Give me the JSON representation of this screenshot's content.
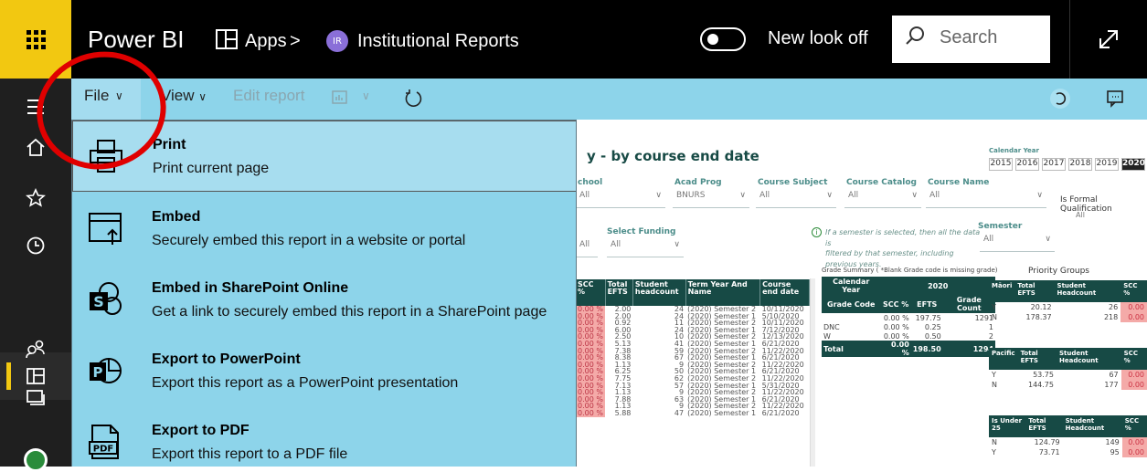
{
  "topbar": {
    "brand": "Power BI",
    "apps_label": "Apps",
    "separator": ">",
    "report_badge": "IR",
    "report_name": "Institutional Reports",
    "new_look_label": "New look off",
    "search_placeholder": "Search"
  },
  "commandbar": {
    "file_label": "File",
    "view_label": "View",
    "edit_label": "Edit report"
  },
  "file_menu": [
    {
      "title": "Print",
      "desc": "Print current page"
    },
    {
      "title": "Embed",
      "desc": "Securely embed this report in a website or portal"
    },
    {
      "title": "Embed in SharePoint Online",
      "desc": "Get a link to securely embed this report in a SharePoint page"
    },
    {
      "title": "Export to PowerPoint",
      "desc": "Export this report as a PowerPoint presentation"
    },
    {
      "title": "Export to PDF",
      "desc": "Export this report to a PDF file"
    }
  ],
  "report": {
    "title": "y  -  by course end date",
    "calendar_year_label": "Calendar Year",
    "years": [
      "2015",
      "2016",
      "2017",
      "2018",
      "2019",
      "2020"
    ],
    "selected_year": "2020",
    "filters": {
      "school_label": "chool",
      "school_value": "All",
      "acad_prog_label": "Acad Prog",
      "acad_prog_value": "BNURS",
      "course_subject_label": "Course Subject",
      "course_subject_value": "All",
      "course_catalog_label": "Course Catalog",
      "course_catalog_value": "All",
      "course_name_label": "Course Name",
      "course_name_value": "All",
      "formal_qual_label": "Is Formal Qualification",
      "formal_qual_value": "All",
      "select_funding_label": "Select Funding",
      "select_funding_value": "All",
      "semester_label": "Semester",
      "semester_value": "All",
      "unlabeled_value": "All",
      "note_line1": "If a semester is selected, then all the data is",
      "note_line2": "filtered by that semester, including previous years."
    },
    "main_table": {
      "headers": [
        "SCC %",
        "Total EFTS",
        "Student headcount",
        "Term Year And Name",
        "Course end date"
      ],
      "rows": [
        [
          "0.00 %",
          "2.00",
          "24",
          "(2020) Semester 2",
          "10/11/2020"
        ],
        [
          "0.00 %",
          "2.00",
          "24",
          "(2020) Semester 1",
          "5/10/2020"
        ],
        [
          "0.00 %",
          "0.92",
          "11",
          "(2020) Semester 2",
          "10/11/2020"
        ],
        [
          "0.00 %",
          "6.00",
          "24",
          "(2020) Semester 1",
          "7/12/2020"
        ],
        [
          "0.00 %",
          "2.50",
          "10",
          "(2020) Semester 2",
          "12/13/2020"
        ],
        [
          "0.00 %",
          "5.13",
          "41",
          "(2020) Semester 1",
          "6/21/2020"
        ],
        [
          "0.00 %",
          "7.38",
          "59",
          "(2020) Semester 2",
          "11/22/2020"
        ],
        [
          "0.00 %",
          "8.38",
          "67",
          "(2020) Semester 1",
          "6/21/2020"
        ],
        [
          "0.00 %",
          "1.13",
          "9",
          "(2020) Semester 2",
          "11/22/2020"
        ],
        [
          "0.00 %",
          "6.25",
          "50",
          "(2020) Semester 1",
          "6/21/2020"
        ],
        [
          "0.00 %",
          "7.75",
          "62",
          "(2020) Semester 2",
          "11/22/2020"
        ],
        [
          "0.00 %",
          "7.13",
          "57",
          "(2020) Semester 1",
          "5/31/2020"
        ],
        [
          "0.00 %",
          "1.13",
          "9",
          "(2020) Semester 2",
          "11/22/2020"
        ],
        [
          "0.00 %",
          "7.88",
          "63",
          "(2020) Semester 1",
          "6/21/2020"
        ],
        [
          "0.00 %",
          "1.13",
          "9",
          "(2020) Semester 2",
          "11/22/2020"
        ],
        [
          "0.00 %",
          "5.88",
          "47",
          "(2020) Semester 1",
          "6/21/2020"
        ]
      ]
    },
    "grade_summary": {
      "title": "Grade Summary ( *Blank Grade code is missing grade)",
      "calendar_year_header": "Calendar Year",
      "year_header": "2020",
      "grade_code_header": "Grade Code",
      "headers": [
        "SCC %",
        "EFTS",
        "Grade Count"
      ],
      "rows": [
        [
          "",
          "0.00 %",
          "197.75",
          "1291"
        ],
        [
          "DNC",
          "0.00 %",
          "0.25",
          "1"
        ],
        [
          "W",
          "0.00 %",
          "0.50",
          "2"
        ]
      ],
      "total": [
        "Total",
        "0.00 %",
        "198.50",
        "1294"
      ]
    },
    "priority_groups": {
      "title": "Priority Groups",
      "groups": [
        {
          "name": "Māori",
          "headers": [
            "Total EFTS",
            "Student Headcount",
            "SCC %"
          ],
          "rows": [
            [
              "Y",
              "20.12",
              "26",
              "0.00"
            ],
            [
              "N",
              "178.37",
              "218",
              "0.00"
            ]
          ]
        },
        {
          "name": "Pacific",
          "headers": [
            "Total EFTS",
            "Student Headcount",
            "SCC %"
          ],
          "rows": [
            [
              "Y",
              "53.75",
              "67",
              "0.00"
            ],
            [
              "N",
              "144.75",
              "177",
              "0.00"
            ]
          ]
        },
        {
          "name": "Is Under 25",
          "headers": [
            "Total EFTS",
            "Student Headcount",
            "SCC %"
          ],
          "rows": [
            [
              "N",
              "124.79",
              "149",
              "0.00"
            ],
            [
              "Y",
              "73.71",
              "95",
              "0.00"
            ]
          ]
        }
      ]
    }
  },
  "colors": {
    "topbar": "#000000",
    "waffle": "#f2c811",
    "commandbar": "#8dd4ea",
    "menu_bg": "#8dd4ea",
    "table_header": "#174a45",
    "scc_highlight": "#f4aaa8",
    "annotation": "#e00000"
  }
}
